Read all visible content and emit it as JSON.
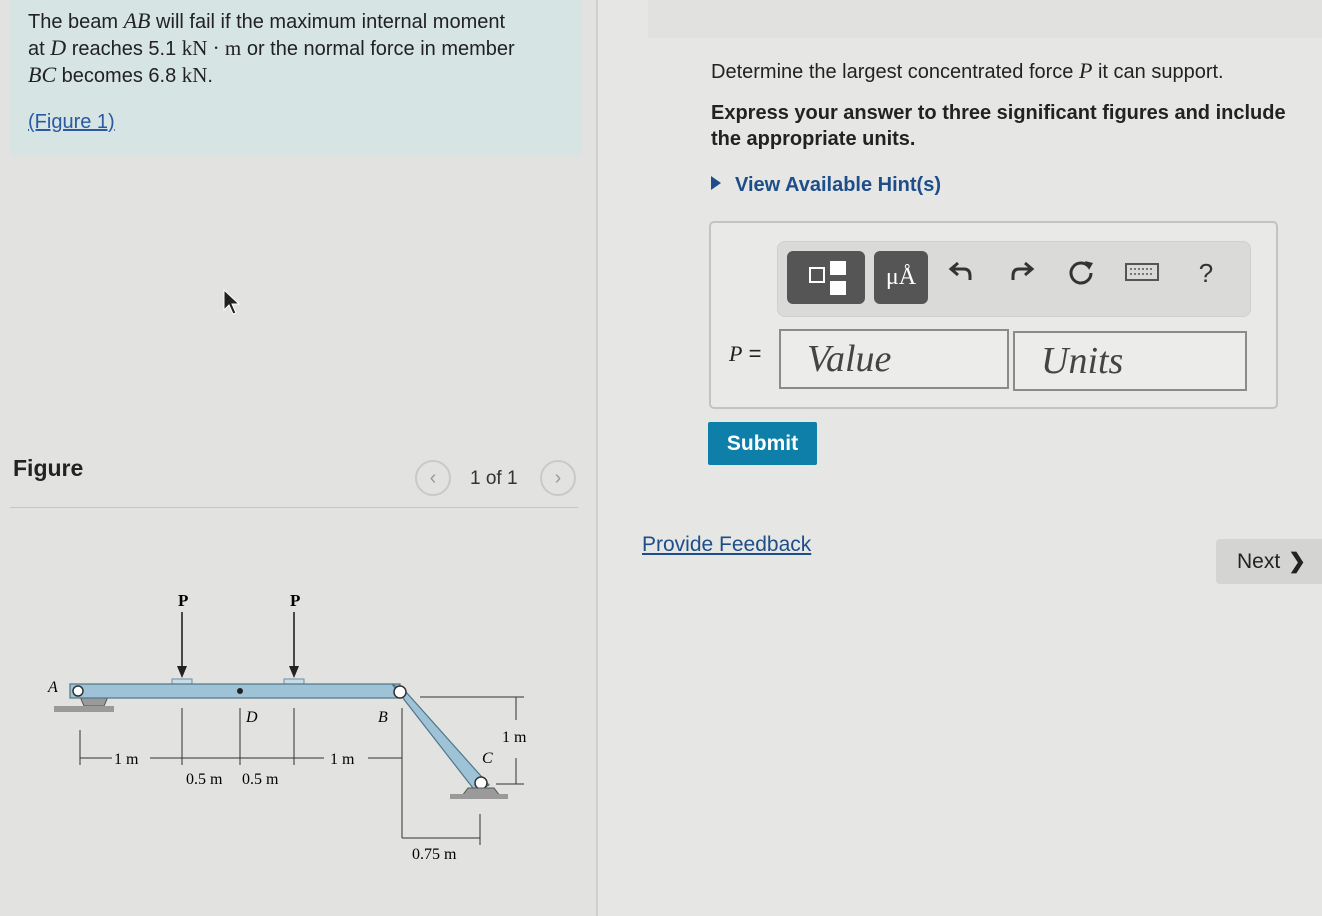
{
  "problem": {
    "line1_pre": "The beam ",
    "line1_var": "AB",
    "line1_post": " will fail if the maximum internal moment",
    "line2_pre": "at ",
    "line2_var": "D",
    "line2_mid": " reaches 5.1 ",
    "line2_unit": "kN · m",
    "line2_post": " or the normal force in member",
    "line3_var": "BC",
    "line3_mid": " becomes 6.8 ",
    "line3_unit": "kN",
    "line3_post": ".",
    "figure_link": "(Figure 1)"
  },
  "figure_panel": {
    "label": "Figure",
    "prev_icon": "chevron-left-icon",
    "next_icon": "chevron-right-icon",
    "pager_text": "1 of 1"
  },
  "figure": {
    "load_left": "P",
    "load_right": "P",
    "point_a": "A",
    "point_d": "D",
    "point_b": "B",
    "point_c": "C",
    "dim_1m_left": "1 m",
    "dim_05_a": "0.5 m",
    "dim_05_b": "0.5 m",
    "dim_1m_mid": "1 m",
    "dim_1m_vert": "1 m",
    "dim_075": "0.75 m"
  },
  "question": {
    "pre": "Determine the largest concentrated force ",
    "var": "P",
    "post": " it can support.",
    "instructions": "Express your answer to three significant figures and include the appropriate units.",
    "hints": "View Available Hint(s)"
  },
  "toolbar": {
    "units_label": "μÅ",
    "undo_icon": "undo-icon",
    "redo_icon": "redo-icon",
    "reset_icon": "reset-icon",
    "keyboard_icon": "keyboard-icon",
    "help": "?"
  },
  "answer": {
    "var": "P",
    "eq": " =",
    "value_placeholder": "Value",
    "units_placeholder": "Units",
    "submit": "Submit"
  },
  "footer": {
    "feedback": "Provide Feedback",
    "next": "Next"
  },
  "colors": {
    "accent": "#0d7fa8",
    "link": "#1d4e89",
    "problem_bg": "#d6e4e3",
    "beam": "#9ec3d6"
  }
}
